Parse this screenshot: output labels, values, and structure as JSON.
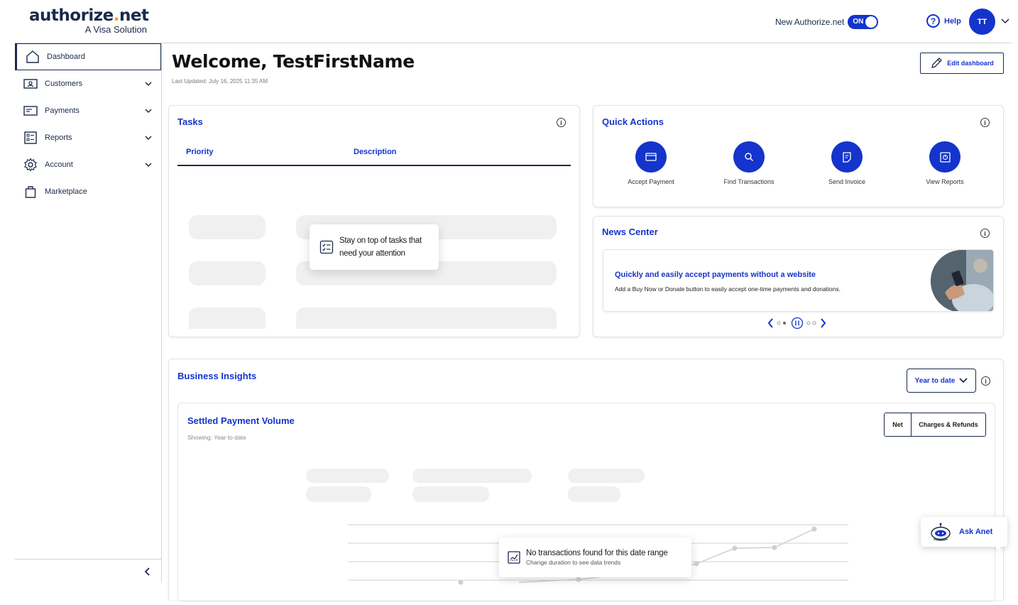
{
  "header": {
    "logo_main": "authorize",
    "logo_dot": ".",
    "logo_tld": "net",
    "logo_sub": "A Visa Solution",
    "toggle_label": "New Authorize.net",
    "toggle_state": "ON",
    "help_label": "Help",
    "avatar_initials": "TT"
  },
  "sidebar": {
    "items": [
      {
        "label": "Dashboard",
        "icon": "home-icon"
      },
      {
        "label": "Customers",
        "icon": "customer-card-icon"
      },
      {
        "label": "Payments",
        "icon": "payment-card-icon"
      },
      {
        "label": "Reports",
        "icon": "report-icon"
      },
      {
        "label": "Account",
        "icon": "gear-icon"
      },
      {
        "label": "Marketplace",
        "icon": "shopping-bag-icon"
      }
    ]
  },
  "main": {
    "title": "Welcome, TestFirstName",
    "last_updated": "Last Updated: July 16, 2025 11:35 AM",
    "edit_dashboard": "Edit dashboard"
  },
  "tasks": {
    "title": "Tasks",
    "col_priority": "Priority",
    "col_description": "Description",
    "tip_line1": "Stay on top of tasks that",
    "tip_line2": "need your attention"
  },
  "quick_actions": {
    "title": "Quick Actions",
    "items": [
      {
        "label": "Accept Payment",
        "icon": "card-icon"
      },
      {
        "label": "Find Transactions",
        "icon": "search-icon"
      },
      {
        "label": "Send Invoice",
        "icon": "invoice-icon"
      },
      {
        "label": "View Reports",
        "icon": "reports-icon"
      }
    ]
  },
  "news": {
    "title": "News Center",
    "headline": "Quickly and easily accept payments without a website",
    "body": "Add a Buy Now or Donate button to easily accept one-time payments and donations."
  },
  "insights": {
    "title": "Business Insights",
    "range_label": "Year to date",
    "chart_title": "Settled Payment Volume",
    "chart_sub": "Showing: Year to date",
    "seg_net": "Net",
    "seg_charges": "Charges & Refunds",
    "empty_title": "No transactions found for this date range",
    "empty_sub": "Change duration to see data trends"
  },
  "ask": {
    "label": "Ask Anet"
  },
  "colors": {
    "brand_blue": "#1434cb",
    "navy": "#1a2a4a",
    "logo_accent": "#f4a300"
  }
}
